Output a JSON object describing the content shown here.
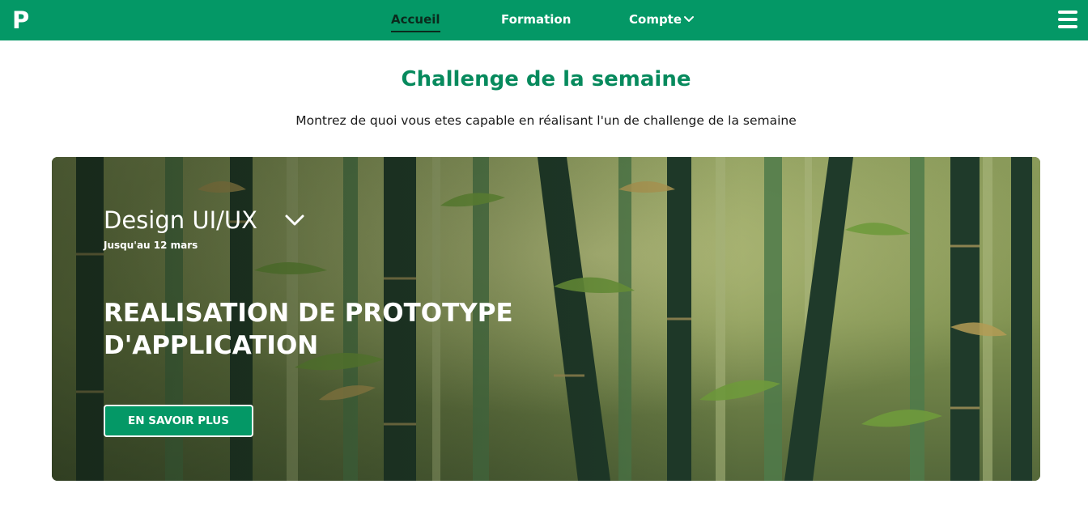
{
  "header": {
    "logo": "P",
    "nav": [
      {
        "label": "Accueil",
        "active": true
      },
      {
        "label": "Formation",
        "active": false
      },
      {
        "label": "Compte",
        "active": false
      }
    ],
    "background_color": "#049866"
  },
  "section": {
    "title": "Challenge de la semaine",
    "subtitle": "Montrez de quoi vous etes capable en réalisant l'un de challenge de la semaine"
  },
  "challenge": {
    "category": "Design UI/UX",
    "deadline": "Jusqu'au 12 mars",
    "title": "REALISATION DE PROTOTYPE D'APPLICATION",
    "cta_label": "EN SAVOIR PLUS",
    "background": "bamboo-forest-illustration"
  },
  "colors": {
    "brand_green": "#049866",
    "title_green": "#078a5d"
  }
}
